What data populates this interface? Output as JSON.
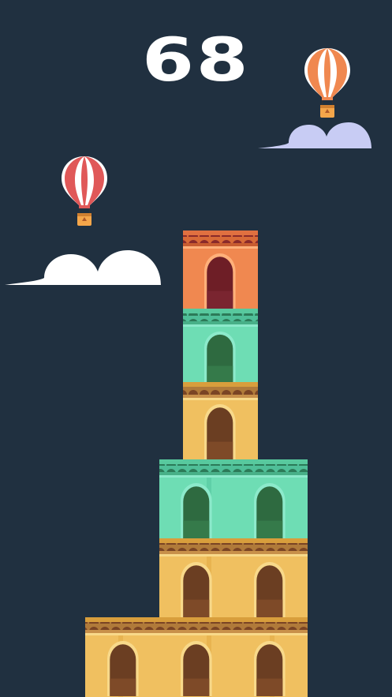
{
  "game": {
    "score": "68",
    "background_color": "#203040",
    "tower_blocks": [
      {
        "row": 1,
        "color": "#F0C060",
        "windows": 3
      },
      {
        "row": 2,
        "color": "#F0C060",
        "windows": 2
      },
      {
        "row": 3,
        "color": "#6EDDB4",
        "windows": 2
      },
      {
        "row": 4,
        "color": "#F0C060",
        "windows": 1
      },
      {
        "row": 5,
        "color": "#6EDDB4",
        "windows": 1
      },
      {
        "row": 6,
        "color": "#F08850",
        "windows": 1
      }
    ],
    "balloons": [
      {
        "name": "balloon-red",
        "stripe_color": "#E05858"
      },
      {
        "name": "balloon-orange",
        "stripe_color": "#F08850"
      }
    ],
    "clouds": [
      {
        "name": "cloud-white",
        "color": "#FFFFFF"
      },
      {
        "name": "cloud-lavender",
        "color": "#C8CCF4"
      }
    ]
  }
}
